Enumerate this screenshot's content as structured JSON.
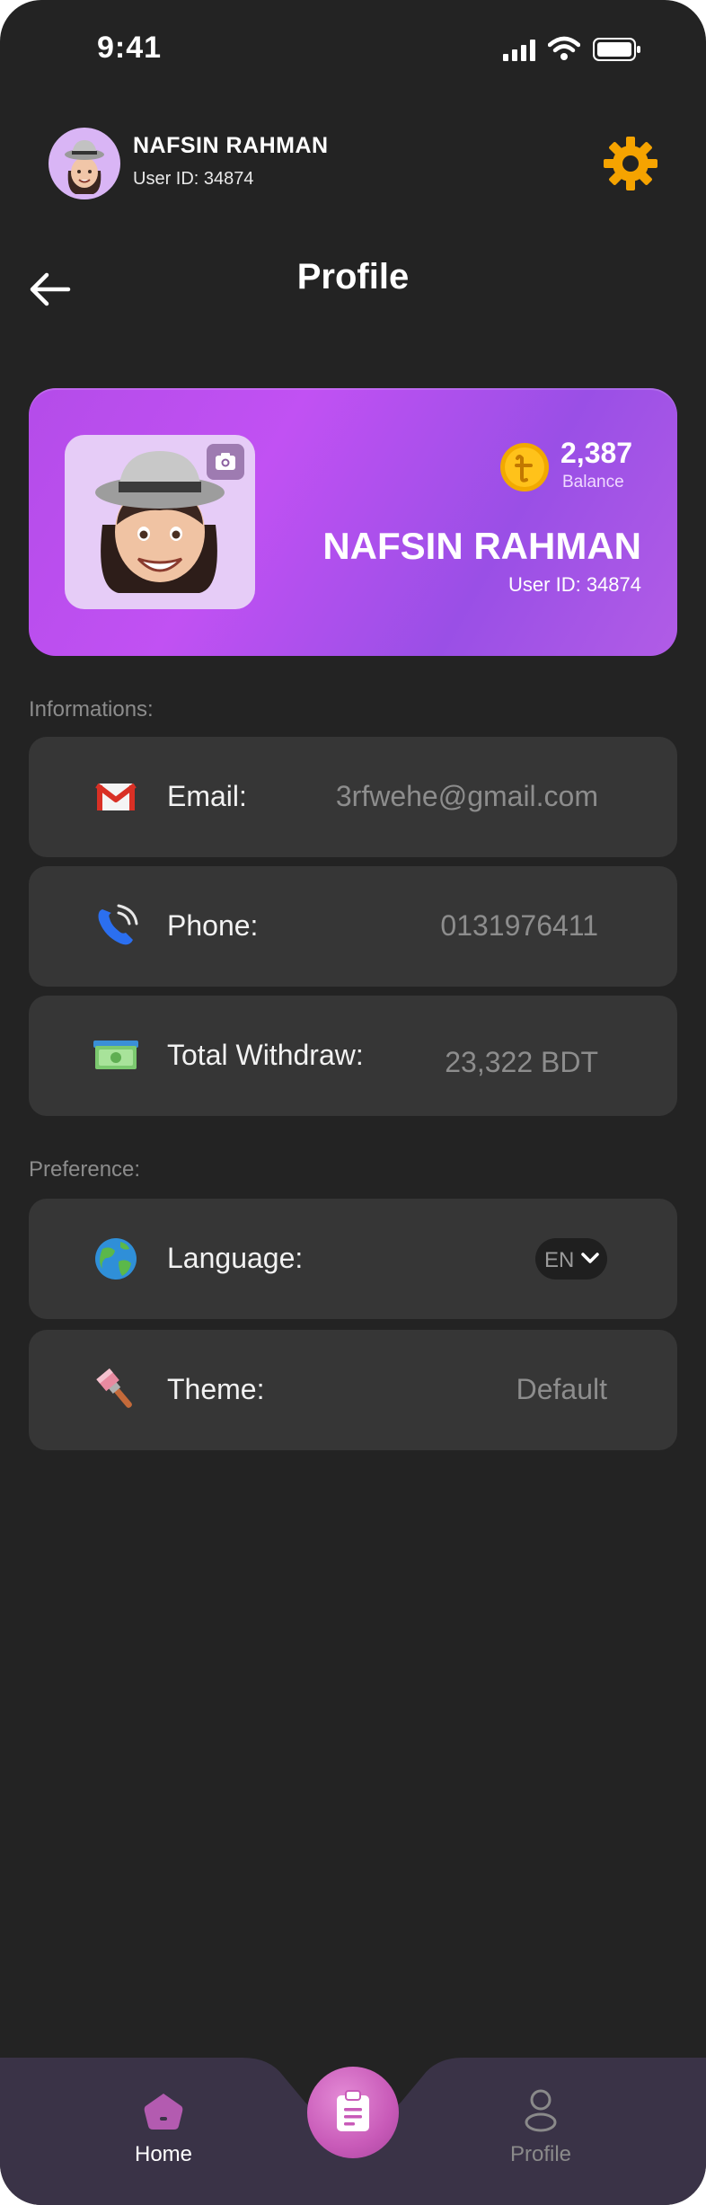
{
  "status_bar": {
    "time": "9:41"
  },
  "header": {
    "name": "NAFSIN RAHMAN",
    "user_id": "User ID: 34874"
  },
  "page": {
    "title": "Profile"
  },
  "card": {
    "balance": "2,387",
    "balance_label": "Balance",
    "name": "NAFSIN RAHMAN",
    "user_id": "User ID: 34874"
  },
  "informations": {
    "section_label": "Informations:",
    "rows": [
      {
        "label": "Email:",
        "value": "3rfwehe@gmail.com",
        "icon": "gmail-icon"
      },
      {
        "label": "Phone:",
        "value": "0131976411",
        "icon": "phone-icon"
      },
      {
        "label": "Total Withdraw:",
        "value": "23,322 BDT",
        "icon": "money-icon"
      }
    ]
  },
  "preference": {
    "section_label": "Preference:",
    "language": {
      "label": "Language:",
      "value": "EN",
      "icon": "globe-icon"
    },
    "theme": {
      "label": "Theme:",
      "value": "Default",
      "icon": "paintbrush-icon"
    }
  },
  "bottom_nav": {
    "home_label": "Home",
    "profile_label": "Profile",
    "active": "Home"
  },
  "colors": {
    "background": "#232323",
    "row": "#363636",
    "accent_purple": "#c151f3",
    "gear": "#f5a300",
    "nav": "#3a3347"
  }
}
